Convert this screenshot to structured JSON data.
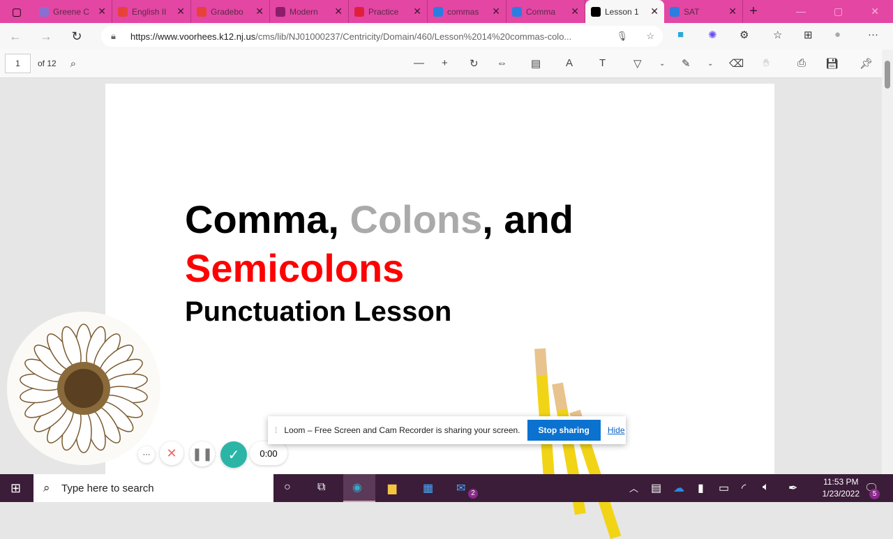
{
  "tabs": [
    {
      "label": "Greene C",
      "color": "#8a6fd0"
    },
    {
      "label": "English II",
      "color": "#e8413a"
    },
    {
      "label": "Gradebo",
      "color": "#e8413a"
    },
    {
      "label": "Modern",
      "color": "#8b1e6b"
    },
    {
      "label": "Practice",
      "color": "#e0203a"
    },
    {
      "label": "commas",
      "color": "#2a7de1"
    },
    {
      "label": "Comma",
      "color": "#2a7de1"
    },
    {
      "label": "Lesson 1",
      "color": "#000000",
      "active": true
    },
    {
      "label": "SAT",
      "color": "#2a7de1"
    }
  ],
  "address": {
    "url_host": "https://www.voorhees.k12.nj.us",
    "url_path": "/cms/lib/NJ01000237/Centricity/Domain/460/Lesson%2014%20commas-colo..."
  },
  "pdf": {
    "page": "1",
    "of": "of 12"
  },
  "document": {
    "t1": "Comma, ",
    "t2": "Colons",
    "t3": ", and",
    "t4": "Semicolons",
    "subtitle": "Punctuation Lesson"
  },
  "loom": {
    "message": "Loom – Free Screen and Cam Recorder is sharing your screen.",
    "stop": "Stop sharing",
    "hide": "Hide",
    "timer": "0:00",
    "more": "···"
  },
  "taskbar": {
    "search_placeholder": "Type here to search",
    "time": "11:53 PM",
    "date": "1/23/2022",
    "notifications": "5",
    "mail_badge": "2"
  },
  "colors": {
    "tabbar": "#e446a4",
    "taskbar": "#3b1d39",
    "red": "#ff0000",
    "gray": "#aaaaaa"
  }
}
